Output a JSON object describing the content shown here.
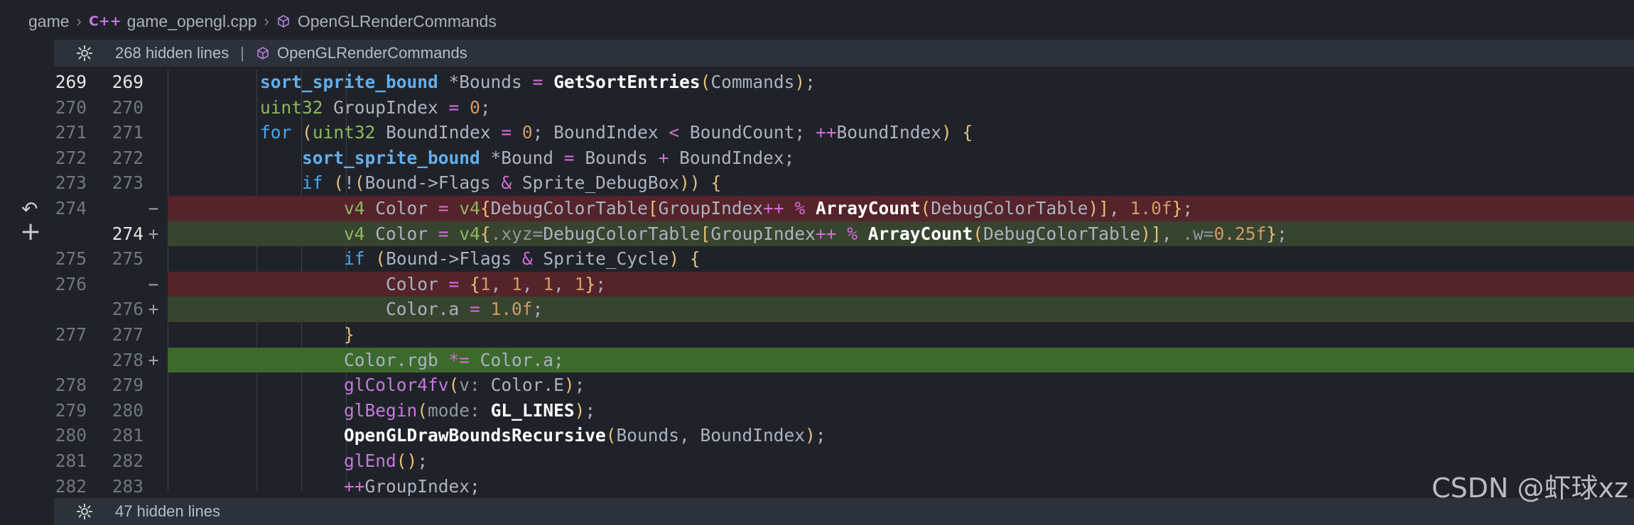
{
  "breadcrumb": {
    "items": [
      "game",
      "game_opengl.cpp",
      "OpenGLRenderCommands"
    ],
    "cpp_badge": "C++"
  },
  "hidden_top": {
    "label": "268 hidden lines",
    "symbol": "OpenGLRenderCommands"
  },
  "hidden_bottom": {
    "label": "47 hidden lines"
  },
  "watermark": "CSDN @虾球xz",
  "colors": {
    "deleted_bg": "#55232a",
    "added_bg": "#37442f",
    "added_strong_bg": "#3c6a2d",
    "editor_bg": "#1f2329"
  },
  "icons": {
    "revert": "revert-icon",
    "add": "plus-icon",
    "gear": "gear-icon",
    "symbol": "symbol-cube-icon"
  },
  "lines": [
    {
      "left": "269",
      "right": "269",
      "marker": "",
      "type": "ctx",
      "code": "        sort_sprite_bound *Bounds = GetSortEntries(Commands);"
    },
    {
      "left": "270",
      "right": "270",
      "marker": "",
      "type": "ctx",
      "code": "        uint32 GroupIndex = 0;"
    },
    {
      "left": "271",
      "right": "271",
      "marker": "",
      "type": "ctx",
      "code": "        for (uint32 BoundIndex = 0; BoundIndex < BoundCount; ++BoundIndex) {"
    },
    {
      "left": "272",
      "right": "272",
      "marker": "",
      "type": "ctx",
      "code": "            sort_sprite_bound *Bound = Bounds + BoundIndex;"
    },
    {
      "left": "273",
      "right": "273",
      "marker": "",
      "type": "ctx",
      "code": "            if (!(Bound->Flags & Sprite_DebugBox)) {"
    },
    {
      "left": "274",
      "right": "",
      "marker": "−",
      "type": "del",
      "code": "                v4 Color = v4{DebugColorTable[GroupIndex++ % ArrayCount(DebugColorTable)], 1.0f};"
    },
    {
      "left": "",
      "right": "274",
      "marker": "+",
      "type": "add",
      "code": "                v4 Color = v4{.xyz=DebugColorTable[GroupIndex++ % ArrayCount(DebugColorTable)], .w=0.25f};"
    },
    {
      "left": "275",
      "right": "275",
      "marker": "",
      "type": "ctx",
      "code": "                if (Bound->Flags & Sprite_Cycle) {"
    },
    {
      "left": "276",
      "right": "",
      "marker": "−",
      "type": "del",
      "code": "                    Color = {1, 1, 1, 1};"
    },
    {
      "left": "",
      "right": "276",
      "marker": "+",
      "type": "add",
      "code": "                    Color.a = 1.0f;"
    },
    {
      "left": "277",
      "right": "277",
      "marker": "",
      "type": "ctx",
      "code": "                }"
    },
    {
      "left": "",
      "right": "278",
      "marker": "+",
      "type": "addstrong",
      "code": "                Color.rgb *= Color.a;"
    },
    {
      "left": "278",
      "right": "279",
      "marker": "",
      "type": "ctx",
      "code": "                glColor4fv(v: Color.E);"
    },
    {
      "left": "279",
      "right": "280",
      "marker": "",
      "type": "ctx",
      "code": "                glBegin(mode: GL_LINES);"
    },
    {
      "left": "280",
      "right": "281",
      "marker": "",
      "type": "ctx",
      "code": "                OpenGLDrawBoundsRecursive(Bounds, BoundIndex);"
    },
    {
      "left": "281",
      "right": "282",
      "marker": "",
      "type": "ctx",
      "code": "                glEnd();"
    },
    {
      "left": "282",
      "right": "283",
      "marker": "",
      "type": "ctx",
      "code": "                ++GroupIndex;"
    }
  ]
}
